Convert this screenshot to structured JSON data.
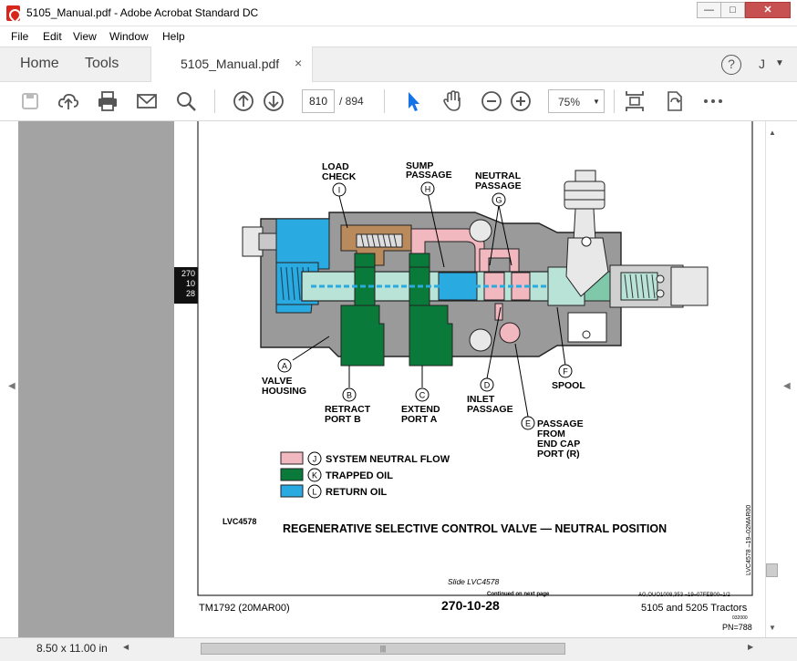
{
  "window": {
    "title": "5105_Manual.pdf - Adobe Acrobat Standard DC",
    "min": "—",
    "max": "□",
    "close": "✕"
  },
  "menu": [
    "File",
    "Edit",
    "View",
    "Window",
    "Help"
  ],
  "tabs": {
    "home": "Home",
    "tools": "Tools",
    "document": "5105_Manual.pdf",
    "close": "×",
    "help": "?",
    "user": "J"
  },
  "toolbar": {
    "page_current": "810",
    "page_total": "/ 894",
    "zoom": "75%"
  },
  "thumb_tag": [
    "270",
    "10",
    "28"
  ],
  "figure": {
    "labels": {
      "load_check": [
        "LOAD",
        "CHECK"
      ],
      "sump_passage": [
        "SUMP",
        "PASSAGE"
      ],
      "neutral_passage": [
        "NEUTRAL",
        "PASSAGE"
      ],
      "valve_housing": [
        "VALVE",
        "HOUSING"
      ],
      "retract_port": [
        "RETRACT",
        "PORT B"
      ],
      "extend_port": [
        "EXTEND",
        "PORT A"
      ],
      "inlet_passage": [
        "INLET",
        "PASSAGE"
      ],
      "spool": [
        "SPOOL"
      ],
      "passage_cap": [
        "PASSAGE",
        "FROM",
        "END CAP",
        "PORT (R)"
      ]
    },
    "letters": {
      "A": "A",
      "B": "B",
      "C": "C",
      "D": "D",
      "E": "E",
      "F": "F",
      "G": "G",
      "H": "H",
      "I": "I"
    },
    "legend": [
      {
        "letter": "J",
        "text": "SYSTEM NEUTRAL FLOW",
        "color": "#f2b8c0"
      },
      {
        "letter": "K",
        "text": "TRAPPED OIL",
        "color": "#0a7a3a"
      },
      {
        "letter": "L",
        "text": "RETURN OIL",
        "color": "#29abe2"
      }
    ],
    "code": "LVC4578",
    "caption": "REGENERATIVE SELECTIVE CONTROL VALVE — NEUTRAL POSITION",
    "side_code": "LVC4578 –19–02MAR00"
  },
  "page_footer": {
    "slide": "Slide LVC4578",
    "continued": "Continued on next page",
    "ag_code": "AG,OUO1008,353   –19–07FEB00–1/2",
    "tm": "TM1792 (20MAR00)",
    "page_num": "270-10-28",
    "tractors": "5105 and 5205 Tractors",
    "small_code": "032000",
    "pn": "PN=788"
  },
  "status": {
    "size": "8.50 x 11.00 in"
  },
  "colors": {
    "pink": "#f2b8c0",
    "green": "#0a7a3a",
    "blue": "#29abe2",
    "housing": "#9a9a9a",
    "brown": "#b98a5c"
  }
}
